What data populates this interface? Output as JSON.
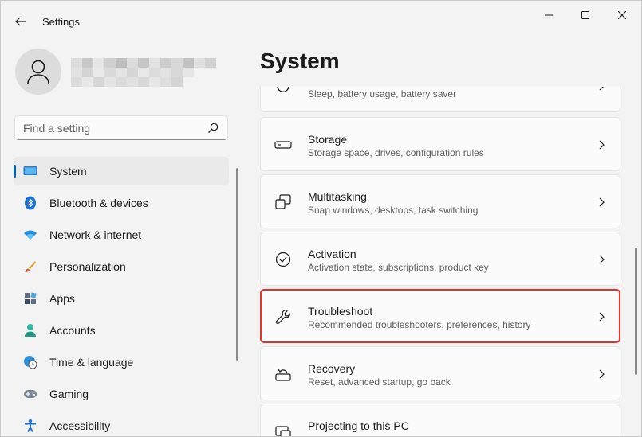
{
  "window": {
    "app_title": "Settings"
  },
  "search": {
    "placeholder": "Find a setting"
  },
  "nav": {
    "items": [
      {
        "label": "System",
        "icon": "monitor-icon",
        "active": true
      },
      {
        "label": "Bluetooth & devices",
        "icon": "bluetooth-icon"
      },
      {
        "label": "Network & internet",
        "icon": "wifi-icon"
      },
      {
        "label": "Personalization",
        "icon": "brush-icon"
      },
      {
        "label": "Apps",
        "icon": "apps-icon"
      },
      {
        "label": "Accounts",
        "icon": "person-icon"
      },
      {
        "label": "Time & language",
        "icon": "globe-clock-icon"
      },
      {
        "label": "Gaming",
        "icon": "gamepad-icon"
      },
      {
        "label": "Accessibility",
        "icon": "accessibility-icon"
      }
    ]
  },
  "main": {
    "title": "System",
    "cards": [
      {
        "title": "",
        "desc": "Sleep, battery usage, battery saver",
        "icon": "power-icon"
      },
      {
        "title": "Storage",
        "desc": "Storage space, drives, configuration rules",
        "icon": "storage-icon"
      },
      {
        "title": "Multitasking",
        "desc": "Snap windows, desktops, task switching",
        "icon": "multitasking-icon"
      },
      {
        "title": "Activation",
        "desc": "Activation state, subscriptions, product key",
        "icon": "check-circle-icon"
      },
      {
        "title": "Troubleshoot",
        "desc": "Recommended troubleshooters, preferences, history",
        "icon": "wrench-icon",
        "highlighted": true
      },
      {
        "title": "Recovery",
        "desc": "Reset, advanced startup, go back",
        "icon": "recovery-icon"
      },
      {
        "title": "Projecting to this PC",
        "desc": "",
        "icon": "projecting-icon"
      }
    ]
  },
  "colors": {
    "accent": "#005fb8",
    "highlight": "#e8302a",
    "background": "#f3f3f3",
    "card": "#fbfbfb"
  }
}
